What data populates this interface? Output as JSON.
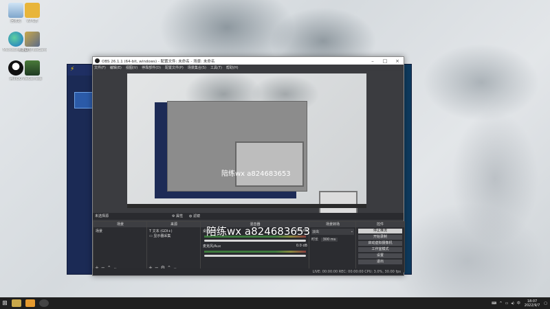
{
  "desktop": {
    "icons": [
      {
        "label": "回收站",
        "icon": "recycle-bin-icon"
      },
      {
        "label": "WPS表",
        "icon": "wps-icon"
      },
      {
        "label": "Microsoft Edge",
        "icon": "edge-icon"
      },
      {
        "label": "英雄联盟 WeGame",
        "icon": "game-icon"
      },
      {
        "label": "腾讯QQ",
        "icon": "qq-icon"
      },
      {
        "label": "WeGame版",
        "icon": "shield-app-icon"
      }
    ]
  },
  "obs": {
    "title": "OBS 26.1.1 (64-bit, windows) - 配置文件: 未命名 - 场景: 未命名",
    "menus": [
      "文件(F)",
      "编辑(E)",
      "视图(V)",
      "停靠部件(D)",
      "配置文件(P)",
      "场景集合(S)",
      "工具(T)",
      "帮助(H)"
    ],
    "no_source": "未选择源",
    "preview_tabs": [
      "属性",
      "滤镜"
    ],
    "panels": {
      "scenes": {
        "title": "场景",
        "items": [
          "场景"
        ]
      },
      "sources": {
        "title": "来源",
        "items": [
          "文本 (GDI+)",
          "显示器采集"
        ]
      },
      "mixer": {
        "title": "混音器",
        "channels": [
          {
            "name": "桌面音频",
            "level": "0.0 dB"
          },
          {
            "name": "麦克风/Aux",
            "level": "0.0 dB"
          }
        ]
      },
      "transitions": {
        "title": "场景转场",
        "type": "淡出",
        "duration_label": "时长",
        "duration": "300 ms"
      },
      "controls": {
        "title": "控件",
        "buttons": [
          "停止推流",
          "开始录制",
          "启动虚拟摄像机",
          "工作室模式",
          "设置",
          "退出"
        ]
      }
    },
    "status": "LIVE: 00:00:00  REC: 00:00:00  CPU: 3.0%, 30.00 fps"
  },
  "watermark": {
    "small": "陪练wx a824683653",
    "large": "陪练wx  a824683653"
  },
  "taskbar": {
    "time": "18:07",
    "date": "2022/9/7"
  }
}
